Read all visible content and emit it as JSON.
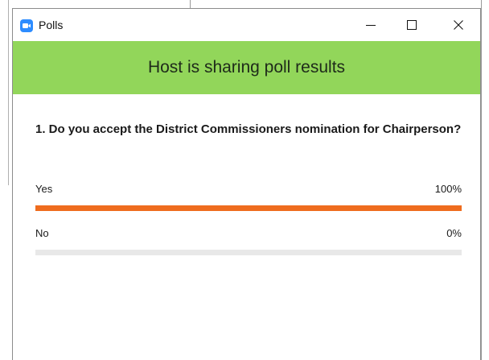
{
  "window": {
    "title": "Polls",
    "app_icon": "zoom-camera-icon",
    "minimize_icon": "minimize-icon",
    "maximize_icon": "maximize-icon",
    "close_icon": "close-icon"
  },
  "banner": {
    "text": "Host is sharing poll results",
    "color": "#92d65a"
  },
  "poll": {
    "question": "1. Do you accept the District Commissioners nomination for Chairperson?",
    "options": [
      {
        "label": "Yes",
        "percent_text": "100%",
        "fraction": 1.0
      },
      {
        "label": "No",
        "percent_text": "0%",
        "fraction": 0.0
      }
    ],
    "bar_color": "#ef6c1e",
    "track_color": "#e8e8e8"
  }
}
